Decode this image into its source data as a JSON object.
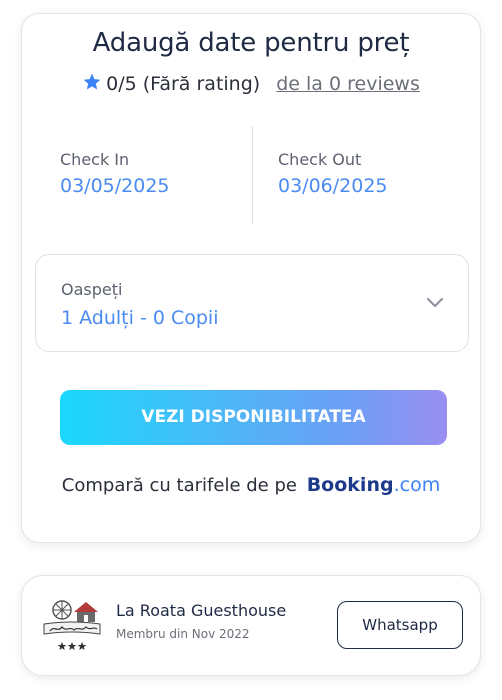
{
  "booking_card": {
    "title": "Adaugă date pentru preț",
    "rating": {
      "score": "0/5",
      "label": "(Fără rating)",
      "reviews_link": "de la 0 reviews",
      "star_color": "#3b82f6"
    },
    "check_in": {
      "label": "Check In",
      "value": "03/05/2025"
    },
    "check_out": {
      "label": "Check Out",
      "value": "03/06/2025"
    },
    "guests": {
      "label": "Oaspeți",
      "value": "1 Adulți - 0 Copii"
    },
    "cta_label": "VEZI DISPONIBILITATEA",
    "compare": {
      "text": "Compară cu tarifele de pe",
      "logo_main": "Booking",
      "logo_suffix": ".com"
    },
    "accent_color": "#4a8bf2"
  },
  "host_card": {
    "logo_icon": "guesthouse-logo-icon",
    "name": "La Roata Guesthouse",
    "member_since": "Membru din Nov 2022",
    "whatsapp_label": "Whatsapp"
  }
}
